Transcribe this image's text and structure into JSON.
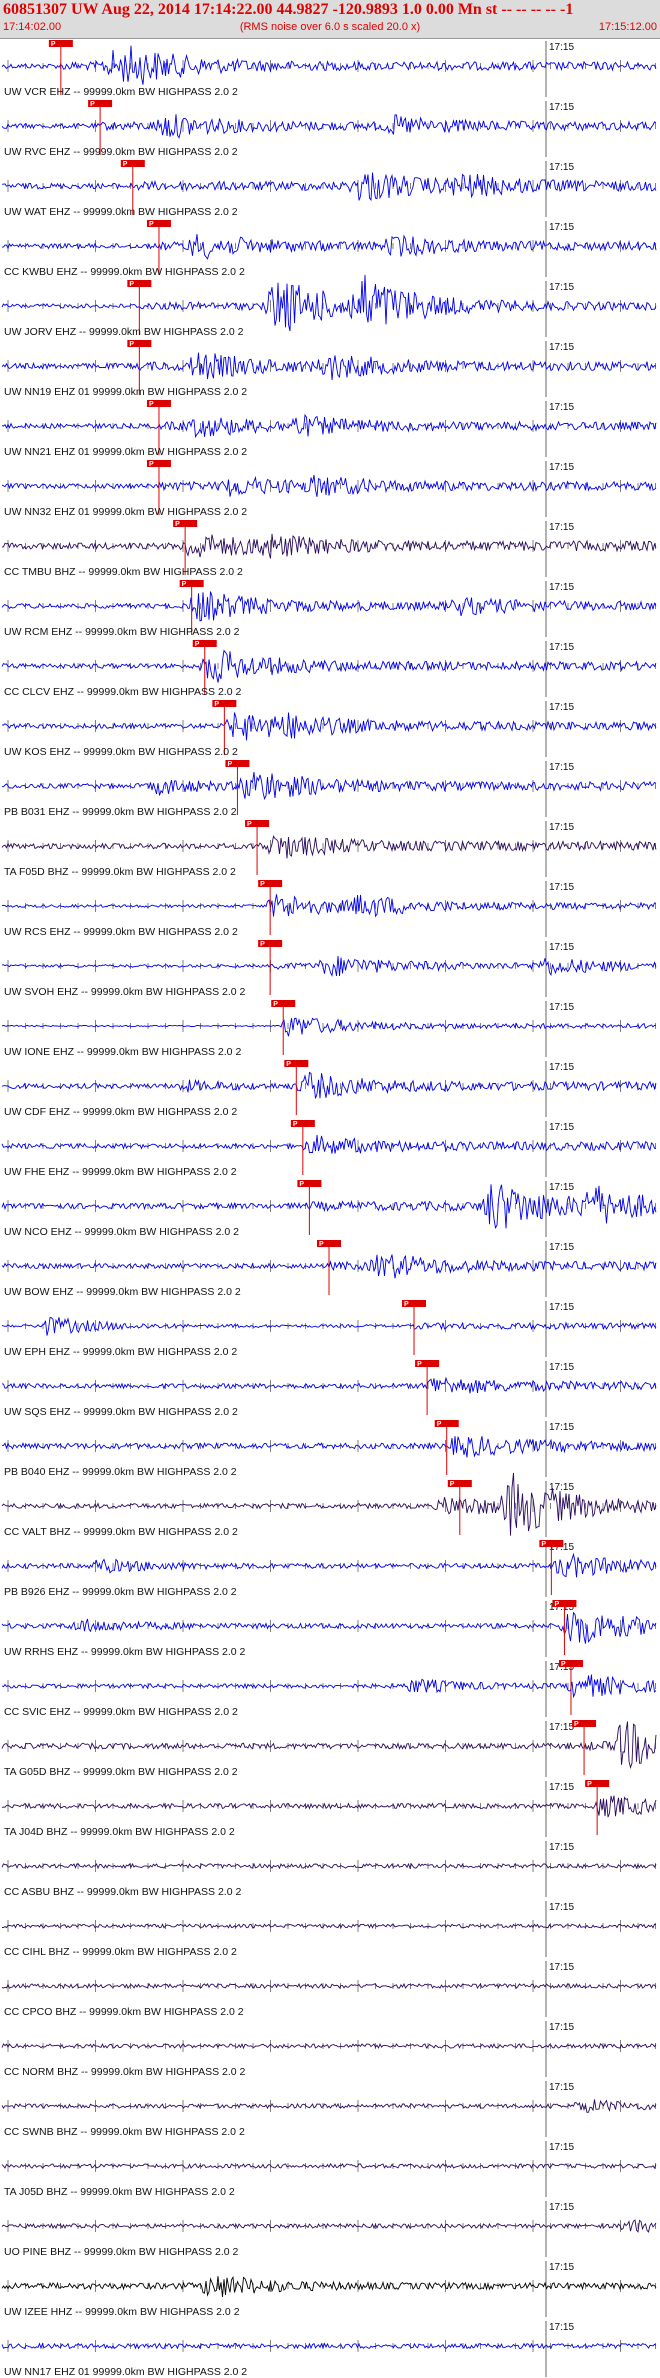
{
  "header": {
    "title": "60851307 UW Aug 22, 2014 17:14:22.00   44.9827 -120.9893  1.0 0.00 Mn st -- -- -- --   -1",
    "start_time": "17:14:02.00",
    "noise_note": "(RMS noise over 6.0 s scaled 20.0 x)",
    "end_time": "17:15:12.00"
  },
  "minute_label": "17:15",
  "pick_label": "P",
  "colors": {
    "blue": "#0000ee",
    "purple": "#2a0a5e",
    "black": "#000000",
    "pick": "#dd0000"
  },
  "traces": [
    {
      "label": "UW VCR EHZ -- 99999.0km BW  HIGHPASS  2.0  2",
      "color": "blue",
      "pick": 0.09,
      "events": [
        [
          0.17,
          1.8
        ],
        [
          0.2,
          1.3
        ]
      ],
      "noise": 0.35
    },
    {
      "label": "UW RVC EHZ -- 99999.0km BW  HIGHPASS  2.0  2",
      "color": "blue",
      "pick": 0.15,
      "events": [
        [
          0.25,
          1.4
        ],
        [
          0.6,
          1.0
        ]
      ],
      "noise": 0.35
    },
    {
      "label": "UW WAT EHZ -- 99999.0km BW  HIGHPASS  2.0  2",
      "color": "blue",
      "pick": 0.2,
      "events": [
        [
          0.55,
          2.0
        ],
        [
          0.7,
          1.2
        ]
      ],
      "noise": 0.4
    },
    {
      "label": "CC KWBU EHZ -- 99999.0km BW  HIGHPASS  2.0  2",
      "color": "blue",
      "pick": 0.24,
      "events": [
        [
          0.3,
          1.5
        ],
        [
          0.6,
          1.1
        ]
      ],
      "noise": 0.35
    },
    {
      "label": "UW JORV EHZ -- 99999.0km BW  HIGHPASS  2.0  2",
      "color": "blue",
      "pick": 0.21,
      "events": [
        [
          0.42,
          4.0
        ],
        [
          0.55,
          3.5
        ]
      ],
      "noise": 0.3
    },
    {
      "label": "UW NN19 EHZ 01 99999.0km BW  HIGHPASS  2.0  2",
      "color": "blue",
      "pick": 0.21,
      "events": [
        [
          0.3,
          1.6
        ],
        [
          0.5,
          1.4
        ]
      ],
      "noise": 0.4
    },
    {
      "label": "UW NN21 EHZ 01 99999.0km BW  HIGHPASS  2.0  2",
      "color": "blue",
      "pick": 0.24,
      "events": [
        [
          0.3,
          1.2
        ],
        [
          0.45,
          1.0
        ]
      ],
      "noise": 0.35
    },
    {
      "label": "UW NN32 EHZ 01 99999.0km BW  HIGHPASS  2.0  2",
      "color": "blue",
      "pick": 0.24,
      "events": [
        [
          0.35,
          1.1
        ],
        [
          0.48,
          1.0
        ]
      ],
      "noise": 0.35
    },
    {
      "label": "CC TMBU BHZ -- 99999.0km BW  HIGHPASS  2.0  2",
      "color": "purple",
      "pick": 0.28,
      "events": [
        [
          0.29,
          1.5
        ],
        [
          0.4,
          1.1
        ]
      ],
      "noise": 0.45
    },
    {
      "label": "UW RCM EHZ -- 99999.0km BW  HIGHPASS  2.0  2",
      "color": "blue",
      "pick": 0.29,
      "events": [
        [
          0.3,
          2.0
        ],
        [
          0.7,
          0.9
        ]
      ],
      "noise": 0.35
    },
    {
      "label": "CC CLCV EHZ -- 99999.0km BW  HIGHPASS  2.0  2",
      "color": "blue",
      "pick": 0.31,
      "events": [
        [
          0.32,
          2.2
        ]
      ],
      "noise": 0.35
    },
    {
      "label": "UW KOS EHZ -- 99999.0km BW  HIGHPASS  2.0  2",
      "color": "blue",
      "pick": 0.34,
      "events": [
        [
          0.36,
          1.8
        ],
        [
          0.43,
          0.9
        ]
      ],
      "noise": 0.35
    },
    {
      "label": "PB B031 EHZ -- 99999.0km BW  HIGHPASS  2.0  2",
      "color": "blue",
      "pick": 0.36,
      "events": [
        [
          0.38,
          2.0
        ],
        [
          0.24,
          1.0
        ]
      ],
      "noise": 0.35
    },
    {
      "label": "TA F05D BHZ -- 99999.0km BW  HIGHPASS  2.0  2",
      "color": "purple",
      "pick": 0.39,
      "events": [
        [
          0.42,
          1.4
        ]
      ],
      "noise": 0.4
    },
    {
      "label": "UW RCS EHZ -- 99999.0km BW  HIGHPASS  2.0  2",
      "color": "blue",
      "pick": 0.41,
      "events": [
        [
          0.42,
          1.6
        ],
        [
          0.55,
          1.2
        ]
      ],
      "noise": 0.2
    },
    {
      "label": "UW SVOH EHZ -- 99999.0km BW  HIGHPASS  2.0  2",
      "color": "blue",
      "pick": 0.41,
      "events": [
        [
          0.5,
          1.3
        ],
        [
          0.83,
          1.0
        ]
      ],
      "noise": 0.2
    },
    {
      "label": "UW IONE EHZ -- 99999.0km BW  HIGHPASS  2.0  2",
      "color": "blue",
      "pick": 0.43,
      "events": [
        [
          0.44,
          1.4
        ]
      ],
      "noise": 0.1
    },
    {
      "label": "UW CDF EHZ -- 99999.0km BW  HIGHPASS  2.0  2",
      "color": "blue",
      "pick": 0.45,
      "events": [
        [
          0.47,
          1.5
        ],
        [
          0.28,
          0.6
        ]
      ],
      "noise": 0.35
    },
    {
      "label": "UW FHE EHZ -- 99999.0km BW  HIGHPASS  2.0  2",
      "color": "blue",
      "pick": 0.46,
      "events": [
        [
          0.48,
          1.0
        ]
      ],
      "noise": 0.35
    },
    {
      "label": "UW NCO EHZ -- 99999.0km BW  HIGHPASS  2.0  2",
      "color": "blue",
      "pick": 0.47,
      "events": [
        [
          0.75,
          3.5
        ],
        [
          0.9,
          2.2
        ]
      ],
      "noise": 0.4
    },
    {
      "label": "UW BOW EHZ -- 99999.0km BW  HIGHPASS  2.0  2",
      "color": "blue",
      "pick": 0.5,
      "events": [
        [
          0.58,
          1.6
        ]
      ],
      "noise": 0.35
    },
    {
      "label": "UW EPH EHZ -- 99999.0km BW  HIGHPASS  2.0  2",
      "color": "blue",
      "pick": 0.63,
      "events": [
        [
          0.07,
          1.3
        ]
      ],
      "noise": 0.2
    },
    {
      "label": "UW SQS EHZ -- 99999.0km BW  HIGHPASS  2.0  2",
      "color": "blue",
      "pick": 0.65,
      "events": [
        [
          0.66,
          1.0
        ]
      ],
      "noise": 0.35
    },
    {
      "label": "PB B040 EHZ -- 99999.0km BW  HIGHPASS  2.0  2",
      "color": "blue",
      "pick": 0.68,
      "events": [
        [
          0.7,
          1.2
        ]
      ],
      "noise": 0.4
    },
    {
      "label": "CC VALT BHZ -- 99999.0km BW  HIGHPASS  2.0  2",
      "color": "purple",
      "pick": 0.7,
      "events": [
        [
          0.78,
          4.0
        ],
        [
          0.68,
          1.2
        ]
      ],
      "noise": 0.35
    },
    {
      "label": "PB B926 EHZ -- 99999.0km BW  HIGHPASS  2.0  2",
      "color": "blue",
      "pick": 0.84,
      "events": [
        [
          0.86,
          1.3
        ],
        [
          0.15,
          0.8
        ]
      ],
      "noise": 0.35
    },
    {
      "label": "UW RRHS EHZ -- 99999.0km BW  HIGHPASS  2.0  2",
      "color": "blue",
      "pick": 0.86,
      "events": [
        [
          0.87,
          2.6
        ],
        [
          0.12,
          0.8
        ]
      ],
      "noise": 0.35
    },
    {
      "label": "CC SVIC EHZ -- 99999.0km BW  HIGHPASS  2.0  2",
      "color": "blue",
      "pick": 0.87,
      "events": [
        [
          0.88,
          1.4
        ],
        [
          0.63,
          0.9
        ]
      ],
      "noise": 0.3
    },
    {
      "label": "TA G05D BHZ -- 99999.0km BW  HIGHPASS  2.0  2",
      "color": "purple",
      "pick": 0.89,
      "events": [
        [
          0.95,
          3.2
        ]
      ],
      "noise": 0.4
    },
    {
      "label": "TA J04D BHZ -- 99999.0km BW  HIGHPASS  2.0  2",
      "color": "purple",
      "pick": 0.91,
      "events": [
        [
          0.92,
          1.2
        ]
      ],
      "noise": 0.35
    },
    {
      "label": "CC ASBU BHZ -- 99999.0km BW  HIGHPASS  2.0  2",
      "color": "purple",
      "pick": -1,
      "events": [],
      "noise": 0.3
    },
    {
      "label": "CC CIHL BHZ -- 99999.0km BW  HIGHPASS  2.0  2",
      "color": "purple",
      "pick": -1,
      "events": [],
      "noise": 0.25
    },
    {
      "label": "CC CPCO BHZ -- 99999.0km BW  HIGHPASS  2.0  2",
      "color": "purple",
      "pick": -1,
      "events": [],
      "noise": 0.3
    },
    {
      "label": "CC NORM BHZ -- 99999.0km BW  HIGHPASS  2.0  2",
      "color": "purple",
      "pick": -1,
      "events": [],
      "noise": 0.3
    },
    {
      "label": "CC SWNB BHZ -- 99999.0km BW  HIGHPASS  2.0  2",
      "color": "purple",
      "pick": -1,
      "events": [
        [
          0.89,
          0.8
        ]
      ],
      "noise": 0.3
    },
    {
      "label": "TA J05D BHZ -- 99999.0km BW  HIGHPASS  2.0  2",
      "color": "purple",
      "pick": -1,
      "events": [],
      "noise": 0.3
    },
    {
      "label": "UO PINE BHZ -- 99999.0km BW  HIGHPASS  2.0  2",
      "color": "purple",
      "pick": -1,
      "events": [
        [
          0.96,
          0.8
        ]
      ],
      "noise": 0.3
    },
    {
      "label": "UW IZEE HHZ -- 99999.0km BW  HIGHPASS  2.0  2",
      "color": "black",
      "pick": -1,
      "events": [
        [
          0.32,
          1.6
        ]
      ],
      "noise": 0.45
    },
    {
      "label": "UW NN17 EHZ 01 99999.0km BW  HIGHPASS  2.0  2",
      "color": "blue",
      "pick": -1,
      "events": [],
      "noise": 0.35
    }
  ]
}
